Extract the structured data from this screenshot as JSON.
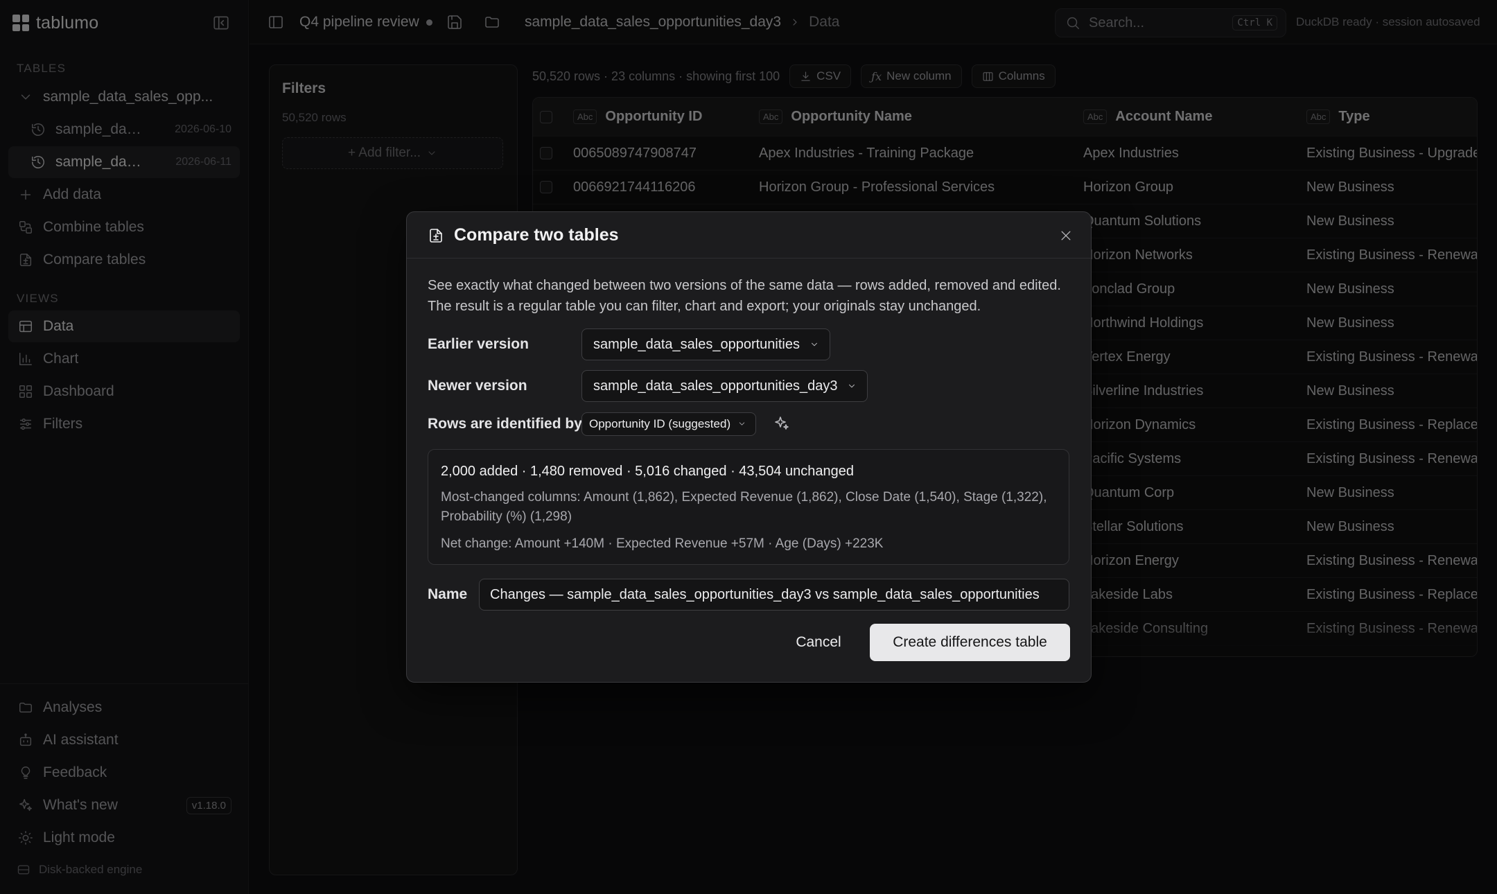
{
  "app": {
    "name": "tablumo"
  },
  "sidebar": {
    "tables_heading": "TABLES",
    "table_parent": "sample_data_sales_opp...",
    "snapshots": [
      {
        "label": "sample_dat...",
        "date": "2026-06-10"
      },
      {
        "label": "sample_dat...",
        "date": "2026-06-11"
      }
    ],
    "actions": [
      "Add data",
      "Combine tables",
      "Compare tables"
    ],
    "views_heading": "VIEWS",
    "views": [
      "Data",
      "Chart",
      "Dashboard",
      "Filters"
    ],
    "bottom": [
      "Analyses",
      "AI assistant",
      "Feedback",
      "What's new",
      "Light mode"
    ],
    "version": "v1.18.0",
    "engine": "Disk-backed engine"
  },
  "topbar": {
    "project": "Q4 pipeline review",
    "breadcrumb_table": "sample_data_sales_opportunities_day3",
    "breadcrumb_view": "Data",
    "search_placeholder": "Search...",
    "shortcut": "Ctrl K",
    "status": "DuckDB ready · session autosaved"
  },
  "filters": {
    "title": "Filters",
    "row_count": "50,520 rows",
    "add_label": "+ Add filter..."
  },
  "data_toolbar": {
    "info": "50,520 rows · 23 columns · showing first 100",
    "csv": "CSV",
    "new_column": "New column",
    "columns": "Columns"
  },
  "table": {
    "type_tag": "Abc",
    "columns": [
      "Opportunity ID",
      "Opportunity Name",
      "Account Name",
      "Type"
    ],
    "rows": [
      [
        "0065089747908747",
        "Apex Industries - Training Package",
        "Apex Industries",
        "Existing Business - Upgrade"
      ],
      [
        "0066921744116206",
        "Horizon Group - Professional Services",
        "Horizon Group",
        "New Business"
      ],
      [
        "",
        "",
        "Quantum Solutions",
        "New Business"
      ],
      [
        "",
        "",
        "Horizon Networks",
        "Existing Business - Renewal"
      ],
      [
        "",
        "",
        "Ironclad Group",
        "New Business"
      ],
      [
        "",
        "",
        "Northwind Holdings",
        "New Business"
      ],
      [
        "",
        "",
        "Vertex Energy",
        "Existing Business - Renewal"
      ],
      [
        "",
        "",
        "Silverline Industries",
        "New Business"
      ],
      [
        "",
        "",
        "Horizon Dynamics",
        "Existing Business - Replacement"
      ],
      [
        "",
        "",
        "Pacific Systems",
        "Existing Business - Renewal"
      ],
      [
        "",
        "",
        "Quantum Corp",
        "New Business"
      ],
      [
        "",
        "",
        "Stellar Solutions",
        "New Business"
      ],
      [
        "",
        "",
        "Horizon Energy",
        "Existing Business - Renewal"
      ],
      [
        "",
        "",
        "Lakeside Labs",
        "Existing Business - Replacement"
      ],
      [
        "",
        "",
        "Lakeside Consulting",
        "Existing Business - Renewal"
      ]
    ]
  },
  "dialog": {
    "title": "Compare two tables",
    "description": "See exactly what changed between two versions of the same data — rows added, removed and edited. The result is a regular table you can filter, chart and export; your originals stay unchanged.",
    "earlier_label": "Earlier version",
    "earlier_value": "sample_data_sales_opportunities",
    "newer_label": "Newer version",
    "newer_value": "sample_data_sales_opportunities_day3",
    "key_label": "Rows are identified by",
    "key_value": "Opportunity ID (suggested)",
    "summary_counts": "2,000 added · 1,480 removed · 5,016 changed · 43,504 unchanged",
    "summary_columns": "Most-changed columns: Amount (1,862), Expected Revenue (1,862), Close Date (1,540), Stage (1,322), Probability (%) (1,298)",
    "summary_net": "Net change: Amount +140M · Expected Revenue +57M · Age (Days) +223K",
    "name_label": "Name",
    "name_value": "Changes — sample_data_sales_opportunities_day3 vs sample_data_sales_opportunities",
    "cancel": "Cancel",
    "create": "Create differences table"
  }
}
